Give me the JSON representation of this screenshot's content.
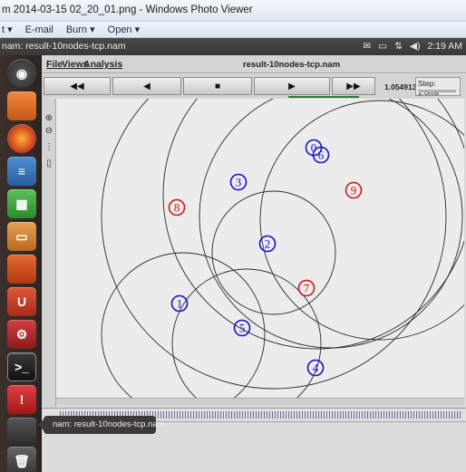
{
  "photo_viewer": {
    "title": "m 2014-03-15 02_20_01.png - Windows Photo Viewer",
    "menu": [
      "t ▾",
      "E-mail",
      "Burn ▾",
      "Open ▾"
    ]
  },
  "ubuntu_panel": {
    "window_title": "nam: result-10nodes-tcp.nam",
    "tray": [
      "✉",
      "▭",
      "⇅",
      "◀)",
      "2:19 AM"
    ]
  },
  "launcher_icons": [
    "dash-icon",
    "files-icon",
    "firefox-icon",
    "writer-icon",
    "calc-icon",
    "impress-icon",
    "software-center-icon",
    "ubuntu-one-icon",
    "settings-icon",
    "terminal-icon",
    "update-icon",
    "workspace-icon",
    "trash-icon"
  ],
  "nam": {
    "menu": {
      "file": "File",
      "views": "Views",
      "analysis": "Analysis",
      "filename": "result-10nodes-tcp.nam"
    },
    "controls": {
      "rewind": "◀◀",
      "back": "◀",
      "stop": "■",
      "play": "▶",
      "forward": "▶▶"
    },
    "time": "1.054913",
    "step": "Step: 2.0ms",
    "tooltip": "nam: result-10nodes-tcp.nam",
    "nodes": [
      {
        "label": "0",
        "color": "#1414c8"
      },
      {
        "label": "6",
        "color": "#1414c8"
      },
      {
        "label": "9",
        "color": "#d01818"
      },
      {
        "label": "3",
        "color": "#1414c8"
      },
      {
        "label": "8",
        "color": "#d01818"
      },
      {
        "label": "2",
        "color": "#1414c8"
      },
      {
        "label": "7",
        "color": "#d01818"
      },
      {
        "label": "1",
        "color": "#1414c8"
      },
      {
        "label": "5",
        "color": "#1414c8"
      },
      {
        "label": "4",
        "color": "#1414c8"
      }
    ]
  }
}
